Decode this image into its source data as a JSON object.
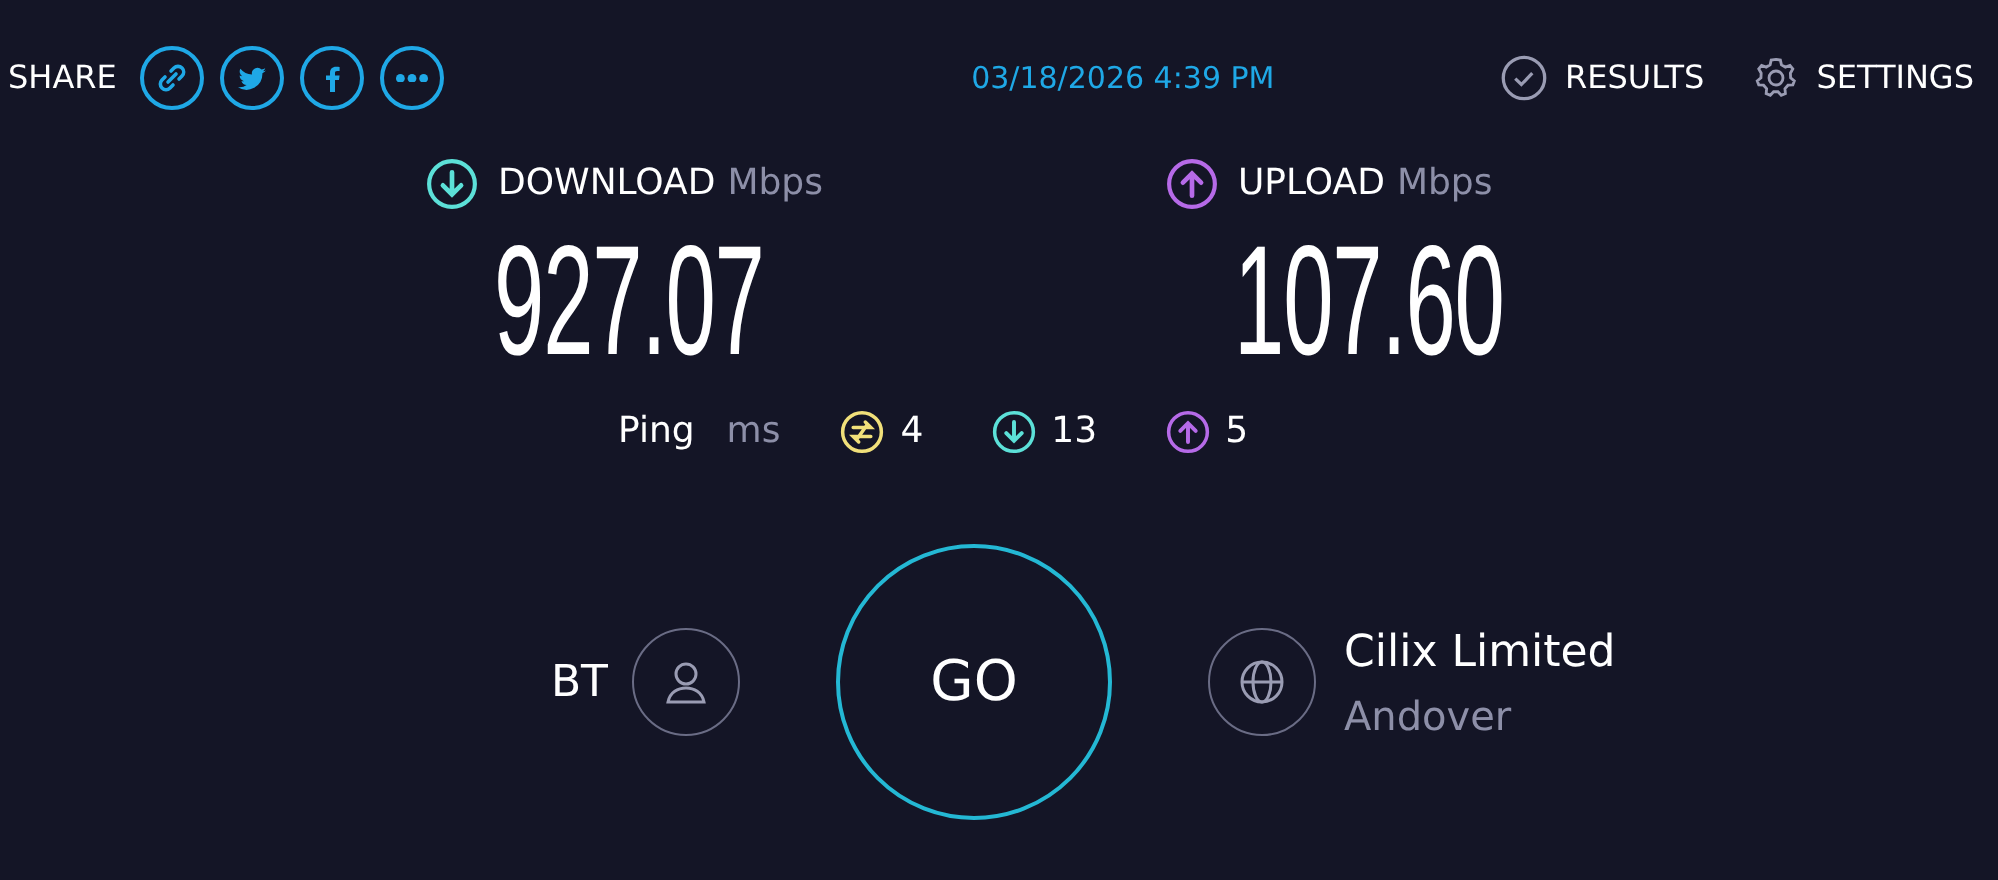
{
  "share": {
    "label": "SHARE",
    "buttons": [
      {
        "kind": "link"
      },
      {
        "kind": "twitter"
      },
      {
        "kind": "facebook"
      },
      {
        "kind": "more"
      }
    ]
  },
  "date": "03/18/2026 4:39 PM",
  "nav": [
    {
      "kind": "results",
      "label": "RESULTS"
    },
    {
      "kind": "settings",
      "label": "SETTINGS"
    }
  ],
  "metrics": [
    {
      "kind": "download",
      "label": "DOWNLOAD",
      "unit": "Mbps",
      "value": "927.07"
    },
    {
      "kind": "upload",
      "label": "UPLOAD",
      "unit": "Mbps",
      "value": "107.60"
    }
  ],
  "ping": {
    "label": "Ping",
    "unit": "ms",
    "readings": [
      {
        "kind": "idle",
        "value": "4"
      },
      {
        "kind": "download",
        "value": "13"
      },
      {
        "kind": "upload",
        "value": "5"
      }
    ]
  },
  "provider": "BT",
  "go": "GO",
  "server": {
    "name": "Cilix Limited",
    "location": "Andover"
  }
}
